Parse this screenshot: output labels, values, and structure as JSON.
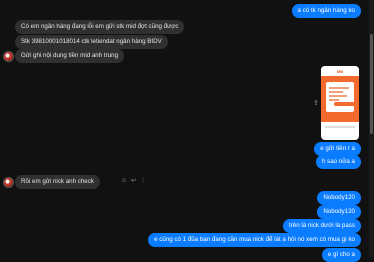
{
  "messages": {
    "out_1": "a có tk ngân hàng ko",
    "in_1": "Có em ngân hàng đang lỗi em gửi stk mid đợt cũng được",
    "in_2": "Stk 39810001018014 ctk letiendat ngân hàng BIDV",
    "in_3": "Gửi ghi nội dung tiền mid anh trung",
    "out_2": "e gửi tiền r a",
    "out_3": "h sao nữa a",
    "in_4": "Rồi em gửi nick anh check",
    "out_4": "Nobody120",
    "out_5": "Nobody120",
    "out_6": "trên là nick dưới là pass",
    "out_7": "e cũng có 1 đũa bạn đang cần mua nick để lát a hỏi nó xem có mua gì ko",
    "out_8": "e gì cho a"
  },
  "attachment": {
    "brand": "MB"
  },
  "icons": {
    "share": "share-icon",
    "smile": "smile-icon",
    "reply": "reply-icon",
    "more": "more-icon"
  },
  "colors": {
    "outgoing": "#0a7cff",
    "incoming": "#303030",
    "background": "#111112"
  }
}
